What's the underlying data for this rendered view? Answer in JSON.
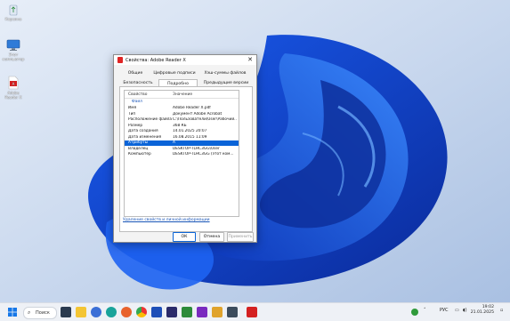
{
  "desktop": {
    "icons": [
      {
        "label": "Корзина",
        "icon": "recycle-bin-icon"
      },
      {
        "label": "Этот компьютер",
        "icon": "computer-icon"
      },
      {
        "label": "Adobe Reader X",
        "icon": "pdf-icon"
      }
    ]
  },
  "dialog": {
    "title": "Свойства: Adobe Reader X",
    "tabs_row1": [
      "Общие",
      "Цифровые подписи",
      "Хэш-суммы файлов"
    ],
    "tabs_row2": [
      "Безопасность",
      "Подробно",
      "Предыдущие версии"
    ],
    "active_tab": "Подробно",
    "columns": {
      "property": "Свойство",
      "value": "Значение"
    },
    "group": "Файл",
    "rows": [
      {
        "k": "Имя",
        "v": "Adobe Reader X.pdf"
      },
      {
        "k": "Тип",
        "v": "Документ Adobe Acrobat"
      },
      {
        "k": "Расположение файла",
        "v": "C:\\Пользователи\\User\\Рабочий..."
      },
      {
        "k": "Размер",
        "v": "368 КБ"
      },
      {
        "k": "Дата создания",
        "v": "14.01.2025 20:07"
      },
      {
        "k": "Дата изменения",
        "v": "16.08.2015 11:09"
      },
      {
        "k": "Атрибуты",
        "v": "A"
      },
      {
        "k": "Владелец",
        "v": "DESKTOP-TLHC3GG\\User"
      },
      {
        "k": "Компьютер",
        "v": "DESKTOP-TLHC3GG (этот ком..."
      }
    ],
    "selected_row": "Атрибуты",
    "remove_link": "Удаление свойств и личной информации",
    "buttons": {
      "ok": "ОК",
      "cancel": "Отмена",
      "apply": "Применить"
    }
  },
  "taskbar": {
    "search_label": "Поиск",
    "language": "РУС",
    "time": "19:02",
    "date": "21.01.2025"
  }
}
